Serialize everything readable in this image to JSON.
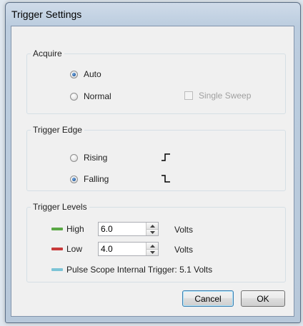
{
  "window": {
    "title": "Trigger Settings"
  },
  "acquire": {
    "legend": "Acquire",
    "auto_label": "Auto",
    "normal_label": "Normal",
    "selected": "Auto",
    "single_sweep_label": "Single Sweep",
    "single_sweep_checked": false,
    "single_sweep_enabled": false
  },
  "edge": {
    "legend": "Trigger Edge",
    "rising_label": "Rising",
    "falling_label": "Falling",
    "selected": "Falling"
  },
  "levels": {
    "legend": "Trigger Levels",
    "high_label": "High",
    "high_value": "6.0",
    "high_unit": "Volts",
    "high_color": "#5aa845",
    "low_label": "Low",
    "low_value": "4.0",
    "low_unit": "Volts",
    "low_color": "#c83a3a",
    "internal_text": "Pulse Scope Internal Trigger: 5.1 Volts",
    "internal_color": "#7cc4d6"
  },
  "buttons": {
    "cancel_label": "Cancel",
    "ok_label": "OK"
  },
  "icons": {
    "rising": "rising-edge-icon",
    "falling": "falling-edge-icon",
    "spin_up": "up-arrow-icon",
    "spin_down": "down-arrow-icon"
  }
}
